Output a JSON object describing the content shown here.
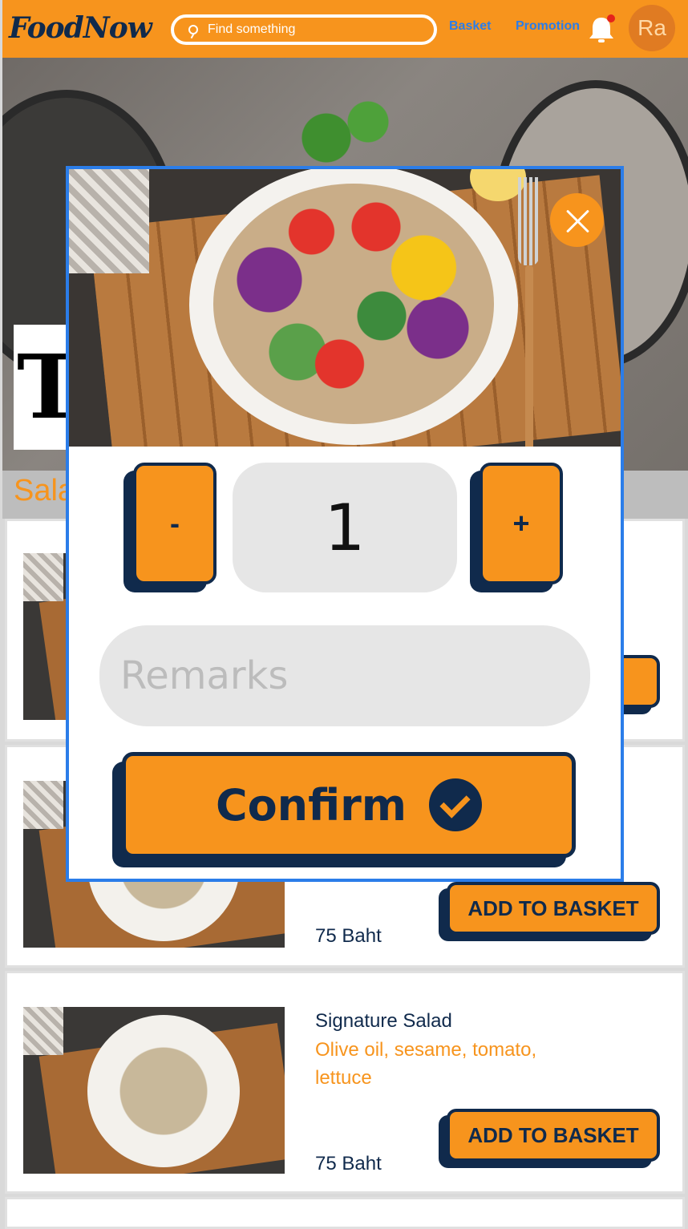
{
  "header": {
    "logo": "FoodNow",
    "search_placeholder": "Find something",
    "nav_basket": "Basket",
    "nav_promotion": "Promotion",
    "avatar_initials": "Ra",
    "icons": [
      "search-icon",
      "bell-icon"
    ]
  },
  "hero": {
    "title_fragment": "T",
    "category_fragment": "Sala"
  },
  "menu": {
    "items": [
      {
        "name": "",
        "description": "",
        "price": "",
        "button": ""
      },
      {
        "name": "",
        "description": "",
        "price": "75 Baht",
        "button": "ADD TO BASKET"
      },
      {
        "name": "Signature Salad",
        "description": "Olive oil, sesame, tomato, lettuce",
        "price": "75 Baht",
        "button": "ADD TO BASKET"
      }
    ]
  },
  "modal": {
    "minus_label": "-",
    "quantity": "1",
    "plus_label": "+",
    "remarks_placeholder": "Remarks",
    "confirm_label": "Confirm"
  },
  "colors": {
    "accent": "#f7941d",
    "navy": "#102a4c",
    "link": "#2b7de9",
    "modal_border": "#2b7de9"
  }
}
